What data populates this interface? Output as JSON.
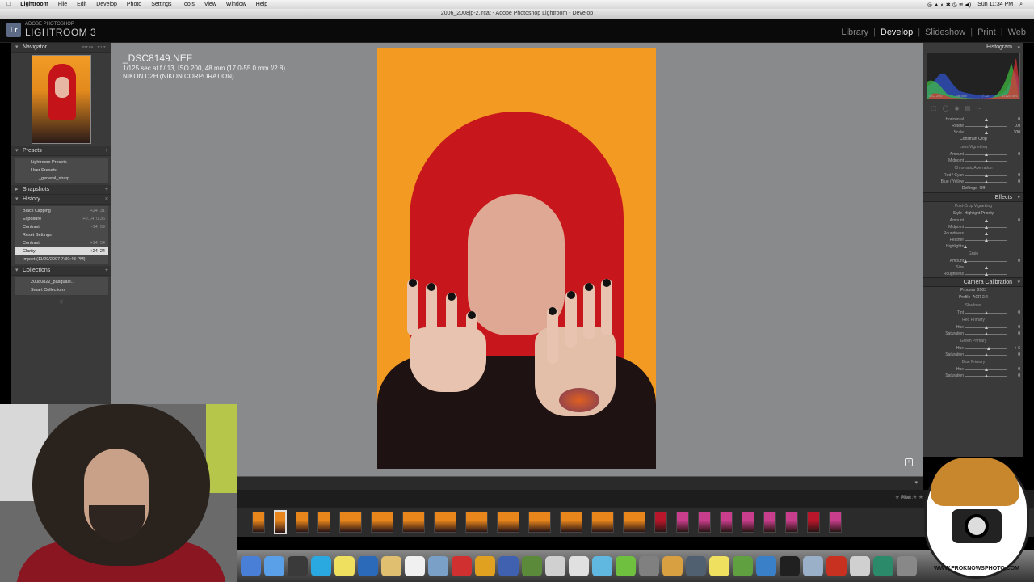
{
  "menubar": {
    "apple": "",
    "items": [
      "Lightroom",
      "File",
      "Edit",
      "Develop",
      "Photo",
      "Settings",
      "Tools",
      "View",
      "Window",
      "Help"
    ],
    "clock": "Sun 11:34 PM"
  },
  "window": {
    "title": "2006_2008jp-2.lrcat - Adobe Photoshop Lightroom - Develop"
  },
  "app": {
    "brand_small": "ADOBE PHOTOSHOP",
    "brand_big": "LIGHTROOM 3",
    "logo_letters": "Lr"
  },
  "modules": [
    "Library",
    "Develop",
    "Slideshow",
    "Print",
    "Web"
  ],
  "active_module": "Develop",
  "left_panel": {
    "navigator": {
      "title": "Navigator",
      "zoom": [
        "FIT",
        "FILL",
        "1:1",
        "3:1"
      ]
    },
    "presets": {
      "title": "Presets",
      "items": [
        "Lightroom Presets",
        "User Presets",
        "_general_sharp"
      ]
    },
    "snapshots": {
      "title": "Snapshots"
    },
    "history": {
      "title": "History",
      "items": [
        {
          "label": "Black Clipping",
          "a": "+24",
          "b": "31"
        },
        {
          "label": "Exposure",
          "a": "+0.14",
          "b": "0.35"
        },
        {
          "label": "Contrast",
          "a": "-14",
          "b": "59"
        },
        {
          "label": "Reset Settings",
          "a": "",
          "b": ""
        },
        {
          "label": "Contrast",
          "a": "+14",
          "b": "54"
        },
        {
          "label": "Clarity",
          "a": "+24",
          "b": "24"
        },
        {
          "label": "Import (11/29/2007 7:30:48 PM)",
          "a": "",
          "b": ""
        }
      ],
      "selected_index": 5
    },
    "collections": {
      "title": "Collections",
      "items": [
        "20080822_pasquale...",
        "Smart Collections"
      ]
    }
  },
  "photo_info": {
    "filename": "_DSC8149.NEF",
    "exposure_line": "1/125 sec at f / 13, ISO 200, 48 mm (17.0-55.0 mm f/2.8)",
    "camera_line": "NIKON D2H (NIKON CORPORATION)"
  },
  "right_panel": {
    "histogram": {
      "title": "Histogram",
      "meta": [
        "ISO 200",
        "48 mm",
        "f / 13",
        "1/125 sec"
      ]
    },
    "lens": {
      "transform_rows": [
        {
          "label": "Horizontal",
          "value": "0",
          "pos": 0.5
        },
        {
          "label": "Rotate",
          "value": "0.0",
          "pos": 0.5
        },
        {
          "label": "Scale",
          "value": "100",
          "pos": 0.5
        }
      ],
      "constrain_crop": "Constrain Crop",
      "vignetting_head": "Lens Vignetting",
      "vignetting_rows": [
        {
          "label": "Amount",
          "value": "0",
          "pos": 0.5
        },
        {
          "label": "Midpoint",
          "value": "",
          "pos": 0.5
        }
      ],
      "ca_head": "Chromatic Aberration",
      "ca_rows": [
        {
          "label": "Red / Cyan",
          "value": "0",
          "pos": 0.5
        },
        {
          "label": "Blue / Yellow",
          "value": "0",
          "pos": 0.5
        }
      ],
      "defringe_label": "Defringe",
      "defringe_value": "Off"
    },
    "effects": {
      "title": "Effects",
      "pcv_head": "Post-Crop Vignetting",
      "style_label": "Style",
      "style_value": "Highlight Priority",
      "pcv_rows": [
        {
          "label": "Amount",
          "value": "0",
          "pos": 0.5
        },
        {
          "label": "Midpoint",
          "value": "",
          "pos": 0.5
        },
        {
          "label": "Roundness",
          "value": "",
          "pos": 0.5
        },
        {
          "label": "Feather",
          "value": "",
          "pos": 0.5
        },
        {
          "label": "Highlights",
          "value": "",
          "pos": 0.0
        }
      ],
      "grain_head": "Grain",
      "grain_rows": [
        {
          "label": "Amount",
          "value": "0",
          "pos": 0.0
        },
        {
          "label": "Size",
          "value": "",
          "pos": 0.5
        },
        {
          "label": "Roughness",
          "value": "",
          "pos": 0.5
        }
      ]
    },
    "calibration": {
      "title": "Camera Calibration",
      "process_label": "Process",
      "process_value": "2003",
      "profile_label": "Profile",
      "profile_value": "ACR 2.4",
      "groups": [
        {
          "head": "Shadows",
          "rows": [
            {
              "label": "Tint",
              "value": "0",
              "pos": 0.5
            }
          ]
        },
        {
          "head": "Red Primary",
          "rows": [
            {
              "label": "Hue",
              "value": "0",
              "pos": 0.5
            },
            {
              "label": "Saturation",
              "value": "0",
              "pos": 0.5
            }
          ]
        },
        {
          "head": "Green Primary",
          "rows": [
            {
              "label": "Hue",
              "value": "+ 6",
              "pos": 0.56
            },
            {
              "label": "Saturation",
              "value": "0",
              "pos": 0.5
            }
          ]
        },
        {
          "head": "Blue Primary",
          "rows": [
            {
              "label": "Hue",
              "value": "0",
              "pos": 0.5
            },
            {
              "label": "Saturation",
              "value": "0",
              "pos": 0.5
            }
          ]
        }
      ]
    }
  },
  "filmstrip": {
    "filter_label": "Filter:",
    "thumb_tones": [
      "orange",
      "orange",
      "orange",
      "orange",
      "orange",
      "orange",
      "orange",
      "orange",
      "orange",
      "orange",
      "orange",
      "orange",
      "orange",
      "orange",
      "red",
      "pink",
      "pink",
      "pink",
      "pink",
      "pink",
      "pink",
      "red",
      "pink"
    ],
    "selected_index": 1
  },
  "overlay_logo": {
    "text": "WWW.FROKNOWSPHOTO.COM"
  },
  "colors": {
    "canvas_bg": "#888a8c",
    "panel_bg": "#3a3a3a",
    "photo_bg": "#f39a22",
    "hair": "#c8171c"
  }
}
